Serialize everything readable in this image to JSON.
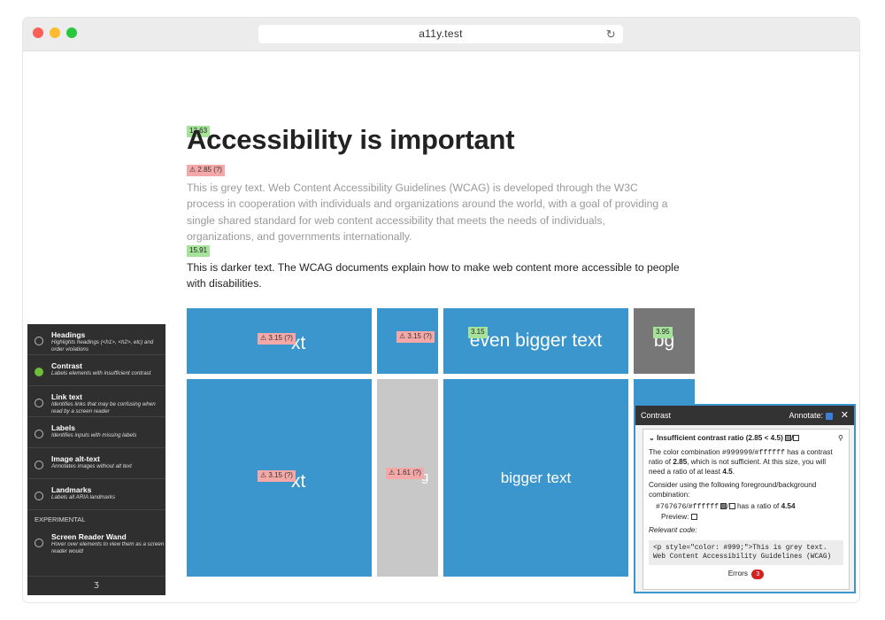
{
  "browser": {
    "url": "a11y.test"
  },
  "content": {
    "title": "Accessibility is important",
    "title_ratio": "12.63",
    "grey_ratio": "⚠ 2.85 (?)",
    "grey_text": "This is grey text. Web Content Accessibility Guidelines (WCAG) is developed through the W3C process in cooperation with individuals and organizations around the world, with a goal of providing a single shared standard for web content accessibility that meets the needs of individuals, organizations, and governments internationally.",
    "dark_ratio": "15.91",
    "dark_text": "This is darker text. The WCAG documents explain how to make web content more accessible to people with disabilities."
  },
  "tiles": {
    "t1_frag": "xt",
    "t1_ratio": "⚠ 3.15 (?)",
    "t2_ratio": "⚠ 3.15 (?)",
    "t3_text": "even bigger text",
    "t3_ratio": "3.15",
    "t4_text": "bg",
    "t4_ratio": "3.95",
    "t5_frag": "xt",
    "t5_ratio": "⚠ 3.15 (?)",
    "t6_frag": "g",
    "t6_ratio": "⚠ 1.61 (?)",
    "t7_text": "bigger text"
  },
  "sidebar": {
    "items": [
      {
        "title": "Headings",
        "desc": "Highlights headings (<h1>, <h2>, etc) and order violations"
      },
      {
        "title": "Contrast",
        "desc": "Labels elements with insufficient contrast"
      },
      {
        "title": "Link text",
        "desc": "Identifies links that may be confusing when read by a screen reader"
      },
      {
        "title": "Labels",
        "desc": "Identifies inputs with missing labels"
      },
      {
        "title": "Image alt-text",
        "desc": "Annotates images without alt text"
      },
      {
        "title": "Landmarks",
        "desc": "Labels all ARIA landmarks"
      }
    ],
    "section": "EXPERIMENTAL",
    "wand": {
      "title": "Screen Reader Wand",
      "desc": "Hover over elements to view them as a screen reader would"
    },
    "footer": "Ⳅ"
  },
  "panel": {
    "title": "Contrast",
    "annotate": "Annotate:",
    "issue": "Insufficient contrast ratio (2.85 < 4.5)",
    "desc_pre": "The color combination",
    "fg": "#999999",
    "bg": "#ffffff",
    "desc_mid": "has a contrast ratio of",
    "ratio": "2.85",
    "desc_post": ", which is not sufficient. At this size, you will need a ratio of at least",
    "min": "4.5",
    "suggest": "Consider using the following foreground/background combination:",
    "s_fg": "#767676",
    "s_bg": "#ffffff",
    "s_mid": "has a ratio of",
    "s_ratio": "4.54",
    "preview": "Preview:",
    "relevant": "Relevant code:",
    "code1": "<p style=\"color: #999;\">This is grey text.",
    "code2": "Web Content Accessibility Guidelines (WCAG)",
    "errors_label": "Errors",
    "errors_count": "3"
  }
}
